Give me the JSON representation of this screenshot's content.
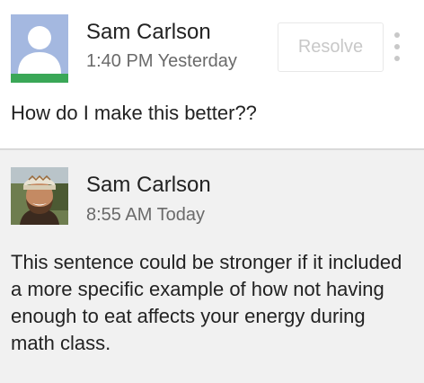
{
  "comments": [
    {
      "author": "Sam Carlson",
      "timestamp": "1:40 PM Yesterday",
      "text": "How do I make this better??",
      "avatar": "default-person-icon",
      "resolve_label": "Resolve",
      "more_icon": "more-vertical-icon"
    },
    {
      "author": "Sam Carlson",
      "timestamp": "8:55 AM Today",
      "text": "This sentence could be stronger if it included a more specific example of how not having enough to eat affects your energy during math class.",
      "avatar": "profile-photo"
    }
  ],
  "colors": {
    "avatar_bg": "#a4b8e0",
    "avatar_strip": "#3aa757",
    "reply_bg": "#f1f1f1",
    "resolve_text": "#c8c8c8"
  }
}
